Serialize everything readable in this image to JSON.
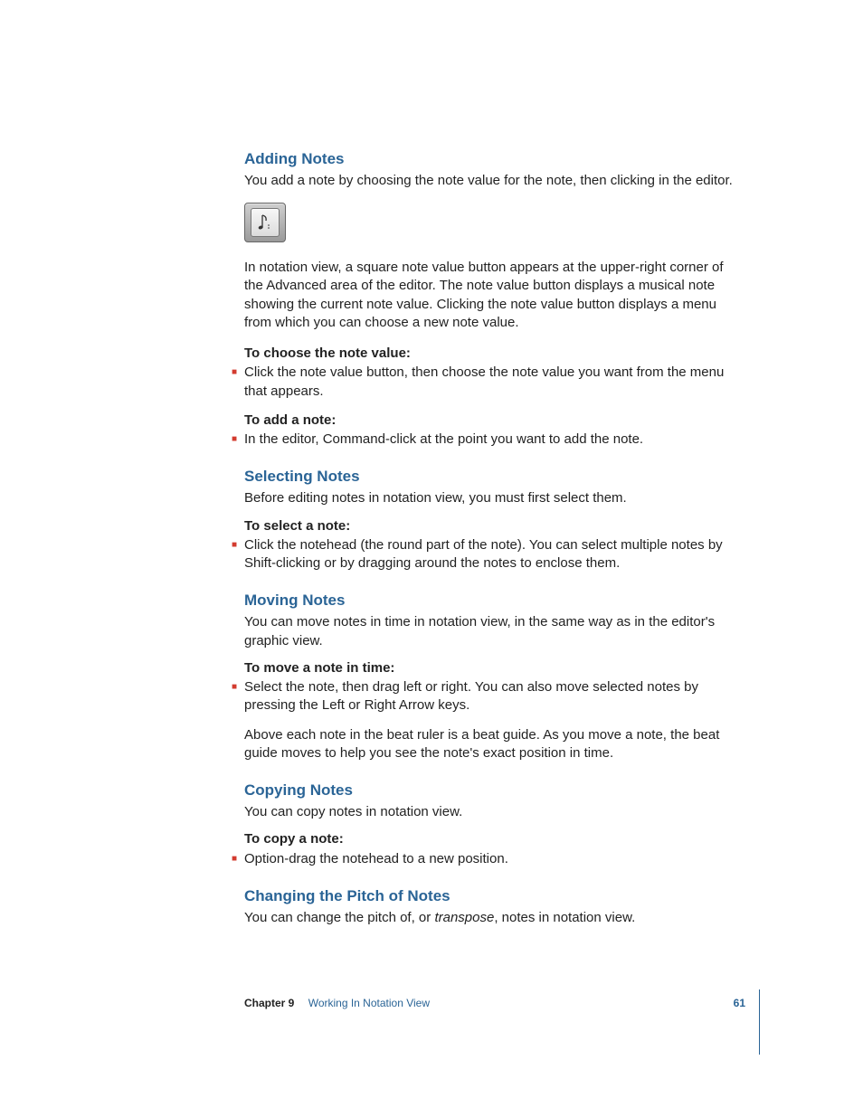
{
  "sections": {
    "adding": {
      "heading": "Adding Notes",
      "p1": "You add a note by choosing the note value for the note, then clicking in the editor.",
      "p2": "In notation view, a square note value button appears at the upper-right corner of the Advanced area of the editor. The note value button displays a musical note showing the current note value. Clicking the note value button displays a menu from which you can choose a new note value.",
      "lead1": "To choose the note value:",
      "bul1": "Click the note value button, then choose the note value you want from the menu that appears.",
      "lead2": "To add a note:",
      "bul2": "In the editor, Command-click at the point you want to add the note."
    },
    "selecting": {
      "heading": "Selecting Notes",
      "p1": "Before editing notes in notation view, you must first select them.",
      "lead1": "To select a note:",
      "bul1": "Click the notehead (the round part of the note). You can select multiple notes by Shift-clicking or by dragging around the notes to enclose them."
    },
    "moving": {
      "heading": "Moving Notes",
      "p1": "You can move notes in time in notation view, in the same way as in the editor's graphic view.",
      "lead1": "To move a note in time:",
      "bul1": "Select the note, then drag left or right. You can also move selected notes by pressing the Left or Right Arrow keys.",
      "p2": "Above each note in the beat ruler is a beat guide. As you move a note, the beat guide moves to help you see the note's exact position in time."
    },
    "copying": {
      "heading": "Copying Notes",
      "p1": "You can copy notes in notation view.",
      "lead1": "To copy a note:",
      "bul1": "Option-drag the notehead to a new position."
    },
    "pitch": {
      "heading": "Changing the Pitch of Notes",
      "p1_pre": "You can change the pitch of, or ",
      "p1_em": "transpose",
      "p1_post": ", notes in notation view."
    }
  },
  "footer": {
    "chapter_label": "Chapter 9",
    "chapter_title": "Working In Notation View",
    "page": "61"
  }
}
